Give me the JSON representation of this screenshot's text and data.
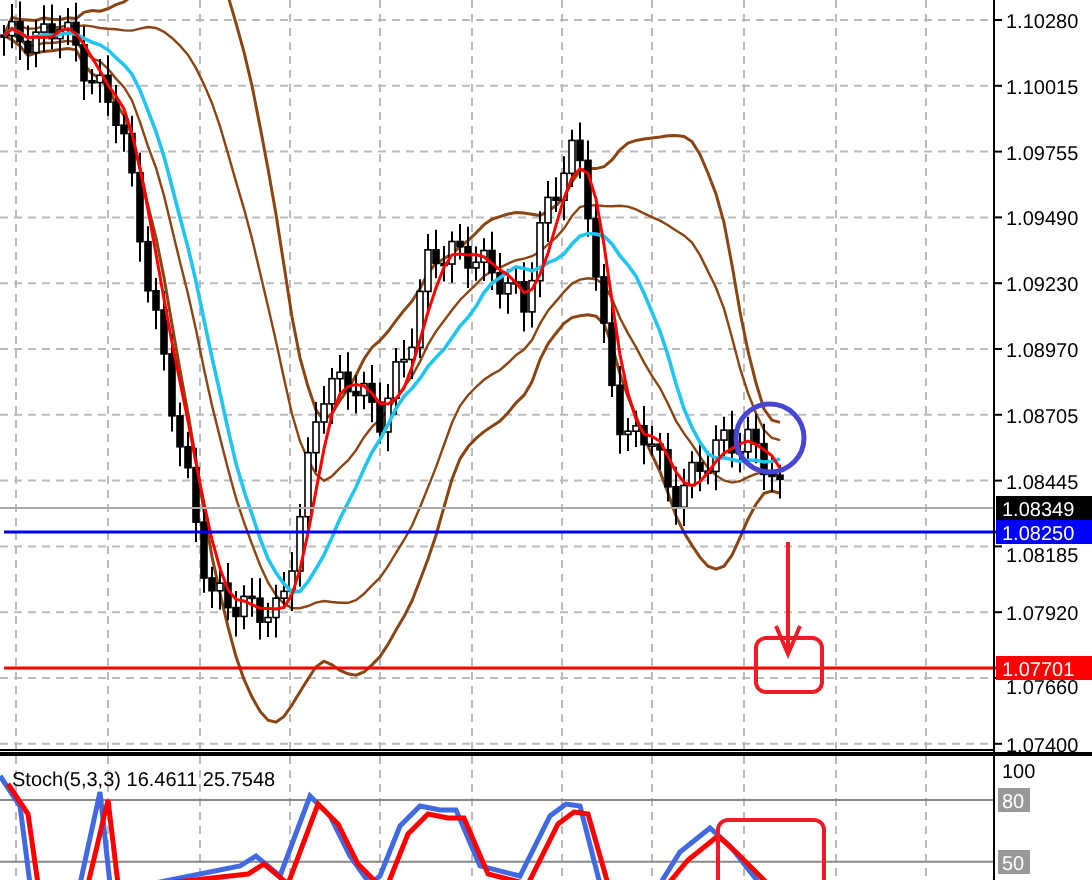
{
  "price_axis": {
    "ticks": [
      "1.10280",
      "1.10015",
      "1.09755",
      "1.09490",
      "1.09230",
      "1.08970",
      "1.08705",
      "1.08445",
      "1.08185",
      "1.07920",
      "1.07660",
      "1.07400"
    ]
  },
  "price_tags": [
    {
      "label": "1.08349",
      "color": "#000000"
    },
    {
      "label": "1.08250",
      "color": "#0000ff"
    },
    {
      "label": "1.07701",
      "color": "#ff0000"
    }
  ],
  "stochastic": {
    "title": "Stoch(5,3,3) 16.4611 25.7548",
    "axis": [
      {
        "label": "100",
        "kind": "plain"
      },
      {
        "label": "80",
        "kind": "level"
      },
      {
        "label": "50",
        "kind": "level"
      }
    ]
  }
}
